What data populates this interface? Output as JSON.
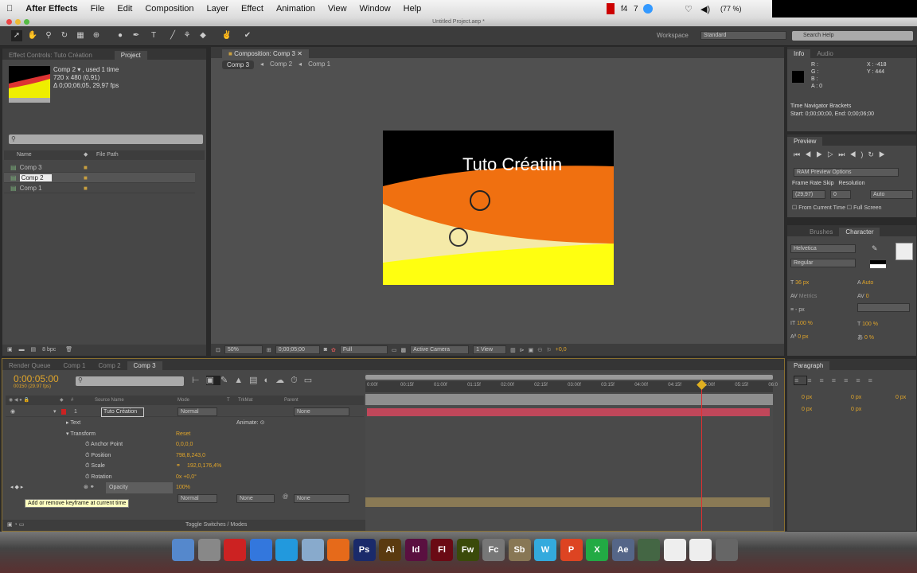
{
  "menubar": {
    "app": "After Effects",
    "items": [
      "File",
      "Edit",
      "Composition",
      "Layer",
      "Effect",
      "Animation",
      "View",
      "Window",
      "Help"
    ],
    "status": [
      "f4",
      "7",
      "(77 %)"
    ]
  },
  "window": {
    "title": "Untitled Project.aep *"
  },
  "toolbar": {
    "workspace_label": "Workspace",
    "workspace_value": "Standard",
    "search_placeholder": "Search Help"
  },
  "project": {
    "tab_effect_controls": "Effect Controls: Tuto Création",
    "tab_project": "Project",
    "info": [
      "Comp 2 ▾ , used 1 time",
      "720 x 480 (0,91)",
      "Δ 0;00;06;05, 29,97 fps"
    ],
    "col_name": "Name",
    "col_file_path": "File Path",
    "items": [
      "Comp 3",
      "Comp 2",
      "Comp 1"
    ],
    "bpc": "8 bpc"
  },
  "composition": {
    "tab": "Composition: Comp 3",
    "breadcrumbs": [
      "Comp 3",
      "Comp 2",
      "Comp 1"
    ],
    "overlay_text": "Tuto Créatiin",
    "zoom": "50%",
    "timecode": "0;00;05;00",
    "resolution": "Full",
    "camera": "Active Camera",
    "views": "1 View",
    "exposure": "+0,0"
  },
  "info": {
    "tab": "Info",
    "tab2": "Audio",
    "r": "R :",
    "g": "G :",
    "b": "B :",
    "a": "A : 0",
    "x": "X : -418",
    "y": "Y : 444",
    "nav_title": "Time Navigator Brackets",
    "nav_range": "Start: 0;00;00;00, End: 0;00;06;00"
  },
  "preview": {
    "tab": "Preview",
    "ram_options": "RAM Preview Options",
    "frame_rate_label": "Frame Rate",
    "skip_label": "Skip",
    "resolution_label": "Resolution",
    "frame_rate": "(29,97)",
    "skip": "0",
    "resolution": "Auto",
    "from_current": "From Current Time",
    "full_screen": "Full Screen"
  },
  "character": {
    "tab_brushes": "Brushes",
    "tab": "Character",
    "font": "Helvetica",
    "style": "Regular",
    "size": "36 px",
    "leading": "Auto",
    "kerning": "Metrics",
    "tracking": "0",
    "stroke": "- px",
    "vscale": "100 %",
    "hscale": "100 %",
    "baseline": "0 px",
    "tsume": "0 %"
  },
  "paragraph": {
    "tab": "Paragraph",
    "values": [
      "0 px",
      "0 px",
      "0 px",
      "0 px",
      "0 px"
    ]
  },
  "timeline": {
    "tabs": [
      "Render Queue",
      "Comp 1",
      "Comp 2",
      "Comp 3"
    ],
    "timecode": "0:00:05:00",
    "fps": "00150 (29.97 fps)",
    "cols": [
      "#",
      "Source Name",
      "Mode",
      "T",
      "TrkMat",
      "Parent"
    ],
    "layer": {
      "num": "1",
      "name": "Tuto Création",
      "mode": "Normal",
      "parent": "None"
    },
    "props": [
      {
        "name": "Text",
        "value": ""
      },
      {
        "name": "Transform",
        "value": "Reset"
      },
      {
        "name": "Anchor Point",
        "value": "0,0,0,0"
      },
      {
        "name": "Position",
        "value": "798,8,243,0"
      },
      {
        "name": "Scale",
        "value": "192,0,176,4%"
      },
      {
        "name": "Rotation",
        "value": "0x +0,0°"
      },
      {
        "name": "Opacity",
        "value": "100%"
      }
    ],
    "animate": "Animate:",
    "layer2": {
      "mode": "Normal",
      "trkmat": "None",
      "parent": "None"
    },
    "tooltip": "Add or remove keyframe at current time",
    "toggle": "Toggle Switches / Modes",
    "ruler": [
      "0:00f",
      "00:15f",
      "01:00f",
      "01:15f",
      "02:00f",
      "02:15f",
      "03:00f",
      "03:15f",
      "04:00f",
      "04:15f",
      "05:00f",
      "05:15f",
      "06:0"
    ],
    "playhead_seconds": 5
  },
  "dock": {
    "items": [
      "Finder",
      "Launchpad",
      "Photo Booth",
      "Safari",
      "Skype",
      "Mail",
      "Firefox",
      "Ps",
      "Ai",
      "Id",
      "Fl",
      "Fw",
      "Fc",
      "Sb",
      "W",
      "P",
      "X",
      "Ae",
      "App",
      "Doc",
      "Doc",
      "Trash"
    ]
  },
  "colors": {
    "accent": "#e0a52a",
    "layer_bar": "#c0475a",
    "playhead": "#e03030"
  }
}
